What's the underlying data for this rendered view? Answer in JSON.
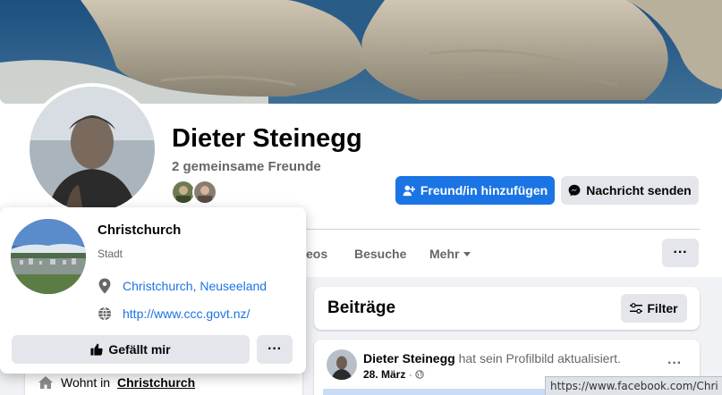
{
  "profile": {
    "name": "Dieter Steinegg",
    "mutual_friends": "2 gemeinsame Freunde"
  },
  "actions": {
    "add_friend": "Freund/in hinzufügen",
    "message": "Nachricht senden"
  },
  "tabs": {
    "videos_partial": "eos",
    "visits": "Besuche",
    "more": "Mehr",
    "more_dots": "···"
  },
  "posts": {
    "title": "Beiträge",
    "filter_label": "Filter"
  },
  "post": {
    "author": "Dieter Steinegg",
    "action": " hat sein Profilbild aktualisiert.",
    "date": "28. März",
    "separator": "·",
    "dots": "···"
  },
  "intro": {
    "lives_prefix": "Wohnt in",
    "lives_city": "Christchurch"
  },
  "hovercard": {
    "title": "Christchurch",
    "subtitle": "Stadt",
    "location": "Christchurch, Neuseeland",
    "website": "http://www.ccc.govt.nz/",
    "like_label": "Gefällt mir",
    "more_dots": "···"
  },
  "statusbar": {
    "url": "https://www.facebook.com/Chri"
  },
  "colors": {
    "accent": "#1b74e4",
    "secondary_button": "#e4e6eb",
    "muted_text": "#65676b",
    "page_bg": "#f0f2f5"
  }
}
